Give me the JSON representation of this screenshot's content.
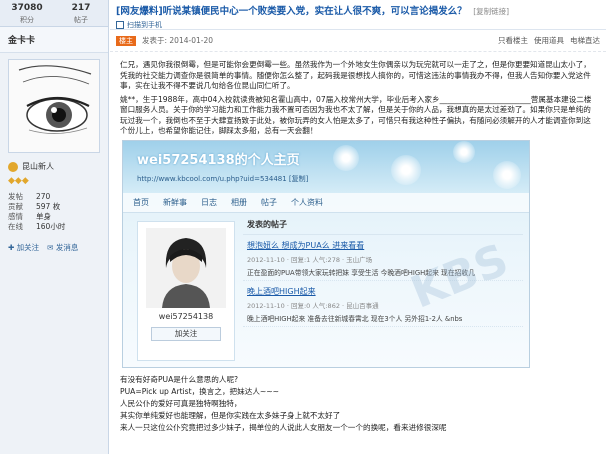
{
  "user": {
    "stats": [
      {
        "num": "37080",
        "label": "积分"
      },
      {
        "num": "217",
        "label": "帖子"
      }
    ],
    "name": "金卡卡",
    "level_label": "昆山新人",
    "info": [
      {
        "k": "发帖",
        "v": "270"
      },
      {
        "k": "贡献",
        "v": "597 枚"
      },
      {
        "k": "感情",
        "v": "单身"
      },
      {
        "k": "在线",
        "v": "160小时"
      }
    ],
    "actions": {
      "follow": "加关注",
      "message": "发消息"
    }
  },
  "thread": {
    "title": "[网友爆料]听说某镇便民中心一个败类要入党，实在让人很不爽，可以言论揭发么？",
    "copy_link": "[复制链接]",
    "qr_link": "扫描到手机",
    "op_badge": "楼主",
    "post_time": "发表于: 2014-01-20",
    "meta_links": [
      "只看楼主",
      "使用道具",
      "电梯直达"
    ]
  },
  "post": {
    "para1": "仁兄，遇见你我很倒霉，但是可能你会更倒霉一些。虽然我作为一个外地女生你偶亲以为玩完就可以一走了之，但是你更要知道昆山太小了，凭我的社交能力调查你是很简单的事情。随便你怎么整了，起码我是很想找人搞你的，可惜这违法的事情我办不得，但我人告知你要入党这件事，实在让我不得不要说几句给各位昆山同仁听了。",
    "para2": "姚**，生于1988年，高中04入校就读贵被知名霍山高中，07届入校常州大学，毕业后考入家乡________________________营属基本建设二楼窗口服务人员。关于你的学习能力和工作能力我不置可否因为我也不太了解，但是关于你的人品，我想真的是太过差劲了。如果你只是单纯的玩过我一个，我倒也不至于大肆宣扬致于此处，被你玩弄的女人怕是太多了，可惜只有我这种性子偏执，有随问必须解开的人才能调查你到这个份儿上，也希望你能记住，脚踩太多船，总有一天会翻！"
  },
  "embed": {
    "title": "wei57254138的个人主页",
    "url": "http://www.kbcool.com/u.php?uid=534481  [复制]",
    "nav": [
      "首页",
      "新鲜事",
      "日志",
      "相册",
      "帖子",
      "个人资料"
    ],
    "username": "wei57254138",
    "follow": "加关注",
    "posts_header": "发表的帖子",
    "posts": [
      {
        "title": "想泡妞么  想成为PUA么  进来看看",
        "meta": "2012-11-10 · 回复:1 人气:278 · 玉山广场",
        "body": "正在盈面的PUA带领大家玩转把妹  享受生活    今晚酒吧HIGH起来  现在招收几"
      },
      {
        "title": "晚上酒吧HIGH起来",
        "meta": "2012-11-10 · 回复:0 人气:862 · 昆山百事通",
        "body": "晚上酒吧HIGH起来  准备去往新城春霄北   现在3个人  另外招1-2人 &nbs"
      }
    ]
  },
  "after": [
    "有没有好奇PUA是什么意思的人呢?",
    "PUA=Pick up Artist，换言之，把妹达人~~~",
    "人民公仆的爱好可真是独特啊独特，",
    "其实你单纯爱好也能理解，但是你实践在太多妹子身上就不太好了",
    "来人一只这位公仆究竟把过多少妹子，揭单位的人说此人女朋友一个一个的换呢，看来进修很深呢"
  ]
}
